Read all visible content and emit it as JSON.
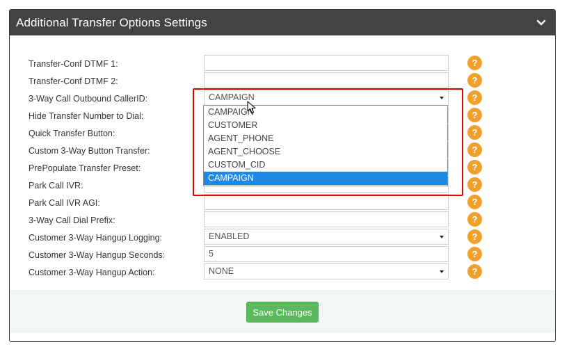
{
  "panel": {
    "title": "Additional Transfer Options Settings",
    "collapse_icon": "chevron-down-icon"
  },
  "rows": [
    {
      "label": "Transfer-Conf DTMF 1:",
      "type": "text",
      "value": ""
    },
    {
      "label": "Transfer-Conf DTMF 2:",
      "type": "text",
      "value": ""
    },
    {
      "label": "3-Way Call Outbound CallerID:",
      "type": "select",
      "value": "CAMPAIGN"
    },
    {
      "label": "Hide Transfer Number to Dial:",
      "type": "select",
      "value": ""
    },
    {
      "label": "Quick Transfer Button:",
      "type": "select",
      "value": ""
    },
    {
      "label": "Custom 3-Way Button Transfer:",
      "type": "select",
      "value": ""
    },
    {
      "label": "PrePopulate Transfer Preset:",
      "type": "select",
      "value": ""
    },
    {
      "label": "Park Call IVR:",
      "type": "select",
      "value": ""
    },
    {
      "label": "Park Call IVR AGI:",
      "type": "text",
      "value": ""
    },
    {
      "label": "3-Way Call Dial Prefix:",
      "type": "text",
      "value": ""
    },
    {
      "label": "Customer 3-Way Hangup Logging:",
      "type": "select",
      "value": "ENABLED"
    },
    {
      "label": "Customer 3-Way Hangup Seconds:",
      "type": "text",
      "value": "5"
    },
    {
      "label": "Customer 3-Way Hangup Action:",
      "type": "select",
      "value": "NONE"
    }
  ],
  "help_icon_text": "?",
  "dropdown": {
    "options": [
      "CAMPAIGN",
      "CUSTOMER",
      "AGENT_PHONE",
      "AGENT_CHOOSE",
      "CUSTOM_CID",
      "CAMPAIGN"
    ],
    "highlighted_index": 5
  },
  "footer": {
    "save_label": "Save Changes"
  },
  "colors": {
    "header_bg": "#434343",
    "help_icon": "#f0a02c",
    "save_button": "#5cb85c",
    "option_highlight": "#1e88e5",
    "annotation_box": "#e00000"
  }
}
